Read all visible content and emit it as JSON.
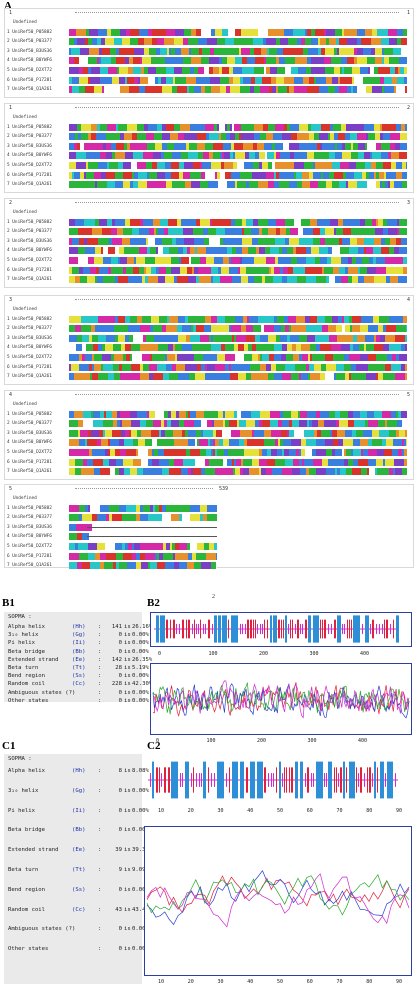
{
  "panels": {
    "a": "A",
    "b1": "B1",
    "b2": "B2",
    "c1": "C1",
    "c2": "C2"
  },
  "page_number": "2",
  "alignment": {
    "sequence_names": [
      "Undefined",
      "1 UniRef50_P05882",
      "2 UniRef50_P03377",
      "3 UniRef50_B3US36",
      "4 UniRef50_B0YWF6",
      "5 UniRef50_D2XT72",
      "6 UniRef50_P17281",
      "7 UniRef50_Q1A261"
    ],
    "blocks": [
      {
        "start": "1",
        "end": "1",
        "end_mark": "1"
      },
      {
        "start": "1",
        "end": "2",
        "end_mark": "2"
      },
      {
        "start": "2",
        "end": "3",
        "end_mark": "3"
      },
      {
        "start": "3",
        "end": "4",
        "end_mark": "4"
      },
      {
        "start": "4",
        "end": "5",
        "end_mark": "5"
      },
      {
        "start": "5",
        "end": "",
        "end_mark": "539"
      }
    ],
    "colors": {
      "green": "#2bb53a",
      "blue": "#3a7fe0",
      "yellow": "#e6e03a",
      "magenta": "#d42aa8",
      "red": "#d8342c",
      "cyan": "#27c6c9",
      "orange": "#e7912c",
      "purple": "#7b3fc6",
      "white": "#ffffff"
    }
  },
  "sopma_b1": {
    "title": "SOPMA :",
    "rows": [
      {
        "name": "Alpha helix",
        "code": "(Hh)",
        "count": "141",
        "is": "is",
        "pct": "26.16%"
      },
      {
        "name": "3₁₀ helix",
        "code": "(Gg)",
        "count": "0",
        "is": "is",
        "pct": "0.00%"
      },
      {
        "name": "Pi helix",
        "code": "(Ii)",
        "count": "0",
        "is": "is",
        "pct": "0.00%"
      },
      {
        "name": "Beta bridge",
        "code": "(Bb)",
        "count": "0",
        "is": "is",
        "pct": "0.00%"
      },
      {
        "name": "Extended strand",
        "code": "(Ee)",
        "count": "142",
        "is": "is",
        "pct": "26.35%"
      },
      {
        "name": "Beta turn",
        "code": "(Tt)",
        "count": "28",
        "is": "is",
        "pct": "5.19%"
      },
      {
        "name": "Bend region",
        "code": "(Ss)",
        "count": "0",
        "is": "is",
        "pct": "0.00%"
      },
      {
        "name": "Random coil",
        "code": "(Cc)",
        "count": "228",
        "is": "is",
        "pct": "42.30%"
      },
      {
        "name": "Ambiguous states (?)",
        "code": "",
        "count": "0",
        "is": "is",
        "pct": "0.00%"
      },
      {
        "name": "Other states",
        "code": "",
        "count": "0",
        "is": "is",
        "pct": "0.00%"
      }
    ]
  },
  "sopma_c1": {
    "title": "SOPMA :",
    "rows": [
      {
        "name": "Alpha helix",
        "code": "(Hh)",
        "count": "8",
        "is": "is",
        "pct": "8.08%"
      },
      {
        "name": "3₁₀ helix",
        "code": "(Gg)",
        "count": "0",
        "is": "is",
        "pct": "0.00%"
      },
      {
        "name": "Pi helix",
        "code": "(Ii)",
        "count": "0",
        "is": "is",
        "pct": "0.00%"
      },
      {
        "name": "Beta bridge",
        "code": "(Bb)",
        "count": "0",
        "is": "is",
        "pct": "0.00%"
      },
      {
        "name": "Extended strand",
        "code": "(Ee)",
        "count": "39",
        "is": "is",
        "pct": "39.39%"
      },
      {
        "name": "Beta turn",
        "code": "(Tt)",
        "count": "9",
        "is": "is",
        "pct": "9.09%"
      },
      {
        "name": "Bend region",
        "code": "(Ss)",
        "count": "0",
        "is": "is",
        "pct": "0.00%"
      },
      {
        "name": "Random coil",
        "code": "(Cc)",
        "count": "43",
        "is": "is",
        "pct": "43.43%"
      },
      {
        "name": "Ambiguous states (?)",
        "code": "",
        "count": "0",
        "is": "is",
        "pct": "0.00%"
      },
      {
        "name": "Other states",
        "code": "",
        "count": "0",
        "is": "is",
        "pct": "0.00%"
      }
    ]
  },
  "chart_data": [
    {
      "type": "line",
      "id": "b2",
      "xticks": [
        "0",
        "100",
        "200",
        "300",
        "400"
      ],
      "xlim": [
        0,
        539
      ],
      "series_colors": [
        "#e0203c",
        "#2a3fd0",
        "#2aa82a",
        "#d02ad0"
      ],
      "track_colors": {
        "helix": "#2d8fd8",
        "strand": "#e0203c",
        "coil": "#d02ad0"
      }
    },
    {
      "type": "line",
      "id": "c2",
      "xticks": [
        "10",
        "20",
        "30",
        "40",
        "50",
        "60",
        "70",
        "80",
        "90"
      ],
      "xlim": [
        0,
        99
      ],
      "series_colors": [
        "#e0203c",
        "#2a3fd0",
        "#2aa82a",
        "#d02ad0"
      ],
      "track_colors": {
        "helix": "#2d8fd8",
        "strand": "#e0203c",
        "coil": "#d02ad0"
      }
    }
  ]
}
